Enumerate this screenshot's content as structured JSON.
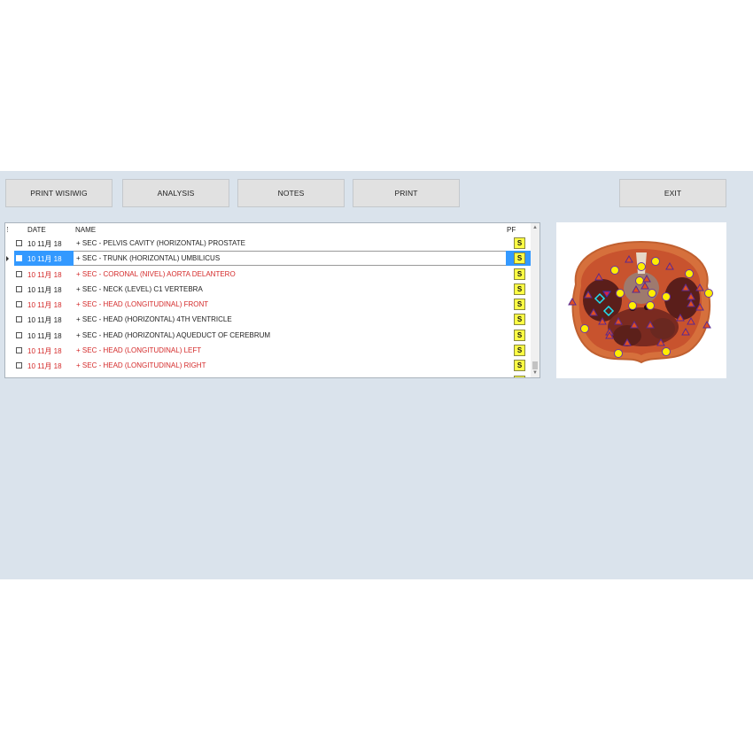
{
  "toolbar": {
    "print_wisiwig": "PRINT WISIWIG",
    "analysis": "ANALYSIS",
    "notes": "NOTES",
    "print": "PRINT",
    "exit": "EXIT"
  },
  "grid": {
    "columns": {
      "date": "DATE",
      "name": "NAME",
      "pf": "PF"
    },
    "rows": [
      {
        "date": "10 11月 18",
        "name": "+ SEC - PELVIS CAVITY (HORIZONTAL) PROSTATE",
        "pf": "S",
        "color": "black",
        "selected": false
      },
      {
        "date": "10 11月 18",
        "name": "+ SEC - TRUNK (HORIZONTAL) UMBILICUS",
        "pf": "S",
        "color": "black",
        "selected": true
      },
      {
        "date": "10 11月 18",
        "name": "+ SEC - CORONAL (NIVEL) AORTA DELANTERO",
        "pf": "S",
        "color": "red",
        "selected": false
      },
      {
        "date": "10 11月 18",
        "name": "+ SEC - NECK (LEVEL) C1 VERTEBRA",
        "pf": "S",
        "color": "black",
        "selected": false
      },
      {
        "date": "10 11月 18",
        "name": "+ SEC - HEAD (LONGITUDINAL) FRONT",
        "pf": "S",
        "color": "red",
        "selected": false
      },
      {
        "date": "10 11月 18",
        "name": "+ SEC - HEAD (HORIZONTAL) 4TH VENTRICLE",
        "pf": "S",
        "color": "black",
        "selected": false
      },
      {
        "date": "10 11月 18",
        "name": "+ SEC - HEAD (HORIZONTAL) AQUEDUCT OF CEREBRUM",
        "pf": "S",
        "color": "black",
        "selected": false
      },
      {
        "date": "10 11月 18",
        "name": "+ SEC - HEAD (LONGITUDINAL) LEFT",
        "pf": "S",
        "color": "red",
        "selected": false
      },
      {
        "date": "10 11月 18",
        "name": "+ SEC - HEAD (LONGITUDINAL) RIGHT",
        "pf": "S",
        "color": "red",
        "selected": false
      }
    ],
    "scroll_arrows": {
      "up": "▲",
      "down": "▼"
    }
  },
  "preview": {
    "description": "Anatomical cross-section (trunk, horizontal, umbilicus level) with point markers",
    "marker_types": [
      "yellow-circle",
      "red-triangle",
      "cyan-diamond"
    ]
  },
  "colors": {
    "panel_bg": "#dae3ec",
    "button_bg": "#e1e1e1",
    "selection": "#3399ff",
    "red_text": "#d42a2a",
    "pf_badge": "#ffff44"
  }
}
